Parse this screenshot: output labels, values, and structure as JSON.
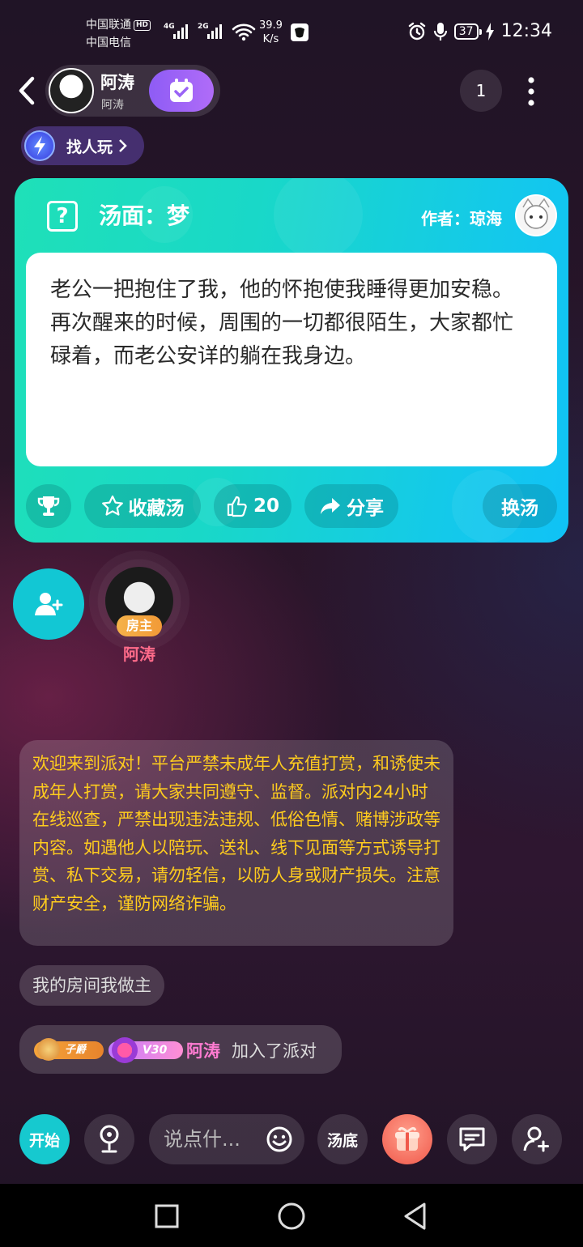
{
  "status_bar": {
    "carrier1": "中国联通",
    "hd": "HD",
    "carrier2": "中国电信",
    "sig1_tag": "4G",
    "sig2_tag": "2G",
    "speed_value": "39.9",
    "speed_unit": "K/s",
    "battery": "37",
    "time": "12:34"
  },
  "header": {
    "host_name": "阿涛",
    "host_sub": "阿涛",
    "online_count": "1"
  },
  "find_play": {
    "label": "找人玩"
  },
  "puzzle": {
    "title": "汤面：梦",
    "author": "作者：琼海",
    "story": "老公一把抱住了我，他的怀抱使我睡得更加安稳。再次醒来的时候，周围的一切都很陌生，大家都忙碌着，而老公安详的躺在我身边。",
    "actions": {
      "favorite": "收藏汤",
      "likes": "20",
      "share": "分享",
      "change": "换汤"
    }
  },
  "seat": {
    "owner_tag": "房主",
    "owner_name": "阿涛"
  },
  "chat": {
    "notice": "欢迎来到派对！平台严禁未成年人充值打赏，和诱使未成年人打赏，请大家共同遵守、监督。派对内24小时在线巡查，严禁出现违法违规、低俗色情、赌博涉政等内容。如遇他人以陪玩、送礼、线下见面等方式诱导打赏、私下交易，请勿轻信，以防人身或财产损失。注意财产安全，谨防网络诈骗。",
    "room_msg": "我的房间我做主",
    "badge1": "子爵",
    "badge2": "V30",
    "join_name": "阿涛",
    "join_text": "加入了派对"
  },
  "bottom_bar": {
    "start": "开始",
    "input_placeholder": "说点什...",
    "answer": "汤底"
  },
  "colors": {
    "card_start": "#1fe0b8",
    "card_end": "#10c2f6",
    "notice_text": "#ffcc1e",
    "owner_name": "#ff6b8a",
    "accent_purple": "#9a63f6"
  }
}
